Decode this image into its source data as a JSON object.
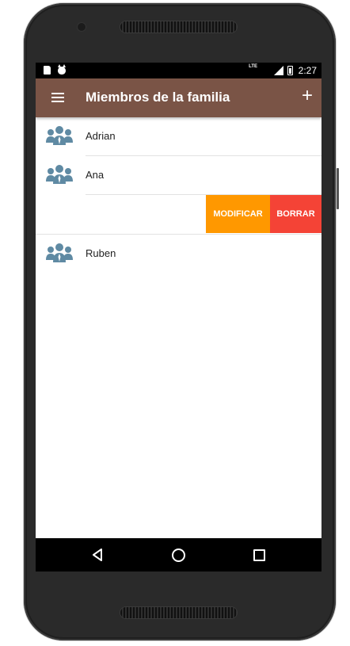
{
  "status_bar": {
    "network": "LTE",
    "time": "2:27"
  },
  "app_bar": {
    "title": "Miembros de la familia",
    "menu_icon": "menu-icon",
    "add_icon": "add-icon"
  },
  "members": [
    {
      "name": "Adrian"
    },
    {
      "name": "Ana"
    },
    {
      "name": "Ruben"
    }
  ],
  "swipe_actions": {
    "modify_label": "MODIFICAR",
    "delete_label": "BORRAR"
  },
  "colors": {
    "app_bar": "#7a5446",
    "modify": "#ff9800",
    "delete": "#f44336",
    "avatar": "#5f8aa3"
  },
  "nav_bar": {
    "back_icon": "back-icon",
    "home_icon": "home-icon",
    "recents_icon": "recents-icon"
  }
}
